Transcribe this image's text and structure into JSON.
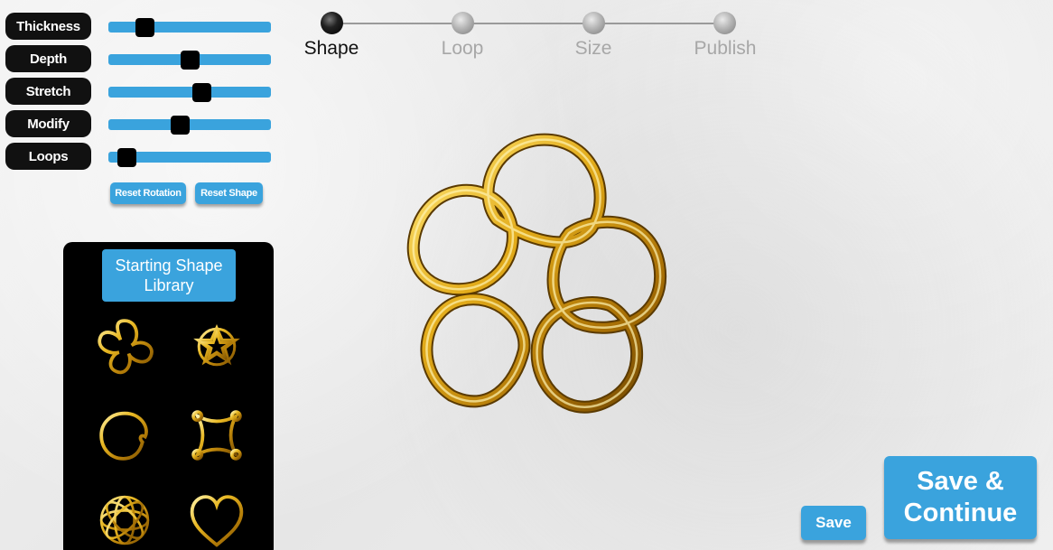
{
  "sliders": [
    {
      "label": "Thickness",
      "value": 0.22
    },
    {
      "label": "Depth",
      "value": 0.5
    },
    {
      "label": "Stretch",
      "value": 0.57
    },
    {
      "label": "Modify",
      "value": 0.44
    },
    {
      "label": "Loops",
      "value": 0.11
    }
  ],
  "controls": {
    "reset_rotation_label": "Reset Rotation",
    "reset_shape_label": "Reset Shape"
  },
  "library": {
    "title_line1": "Starting Shape",
    "title_line2": "Library",
    "shapes": [
      {
        "icon": "pentafoil-knot-icon"
      },
      {
        "icon": "star-knot-icon"
      },
      {
        "icon": "circle-loop-icon"
      },
      {
        "icon": "square-loop-icon"
      },
      {
        "icon": "woven-sphere-icon"
      },
      {
        "icon": "heart-icon"
      }
    ]
  },
  "steps": [
    {
      "label": "Shape",
      "active": true
    },
    {
      "label": "Loop",
      "active": false
    },
    {
      "label": "Size",
      "active": false
    },
    {
      "label": "Publish",
      "active": false
    }
  ],
  "actions": {
    "save_label": "Save",
    "save_continue_line1": "Save &",
    "save_continue_line2": "Continue"
  },
  "colors": {
    "accent": "#3aa3dd",
    "gold": "#e3b21c",
    "panel": "#000000"
  }
}
